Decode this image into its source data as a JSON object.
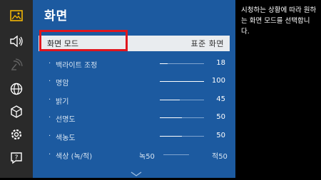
{
  "sidebar": {
    "items": [
      {
        "icon": "picture-icon",
        "active": true
      },
      {
        "icon": "sound-icon"
      },
      {
        "icon": "broadcast-icon",
        "dimmed": true
      },
      {
        "icon": "network-icon"
      },
      {
        "icon": "system-icon"
      },
      {
        "icon": "settings-icon"
      },
      {
        "icon": "support-icon"
      }
    ]
  },
  "panel": {
    "title": "화면",
    "picture_mode": {
      "label": "화면 모드",
      "value": "표준 화면"
    },
    "settings": [
      {
        "label": "백라이트 조정",
        "value": "18",
        "level": 0.18
      },
      {
        "label": "명암",
        "value": "100",
        "level": 1.0
      },
      {
        "label": "밝기",
        "value": "45",
        "level": 0.45
      },
      {
        "label": "선명도",
        "value": "50",
        "level": 0.5
      },
      {
        "label": "색농도",
        "value": "50",
        "level": 0.5
      }
    ],
    "tint": {
      "label": "색상 (녹/적)",
      "left": "녹50",
      "right": "적50"
    },
    "scroll_icon": "chevron-down-icon"
  },
  "info": {
    "text": "시청하는 상황에 따라 원하는 화면 모드를 선택합니다."
  },
  "colors": {
    "panel": "#1c5aa0",
    "sidebar": "#2a2a2a",
    "highlight": "#e0161e",
    "active_icon": "#f2b705"
  }
}
